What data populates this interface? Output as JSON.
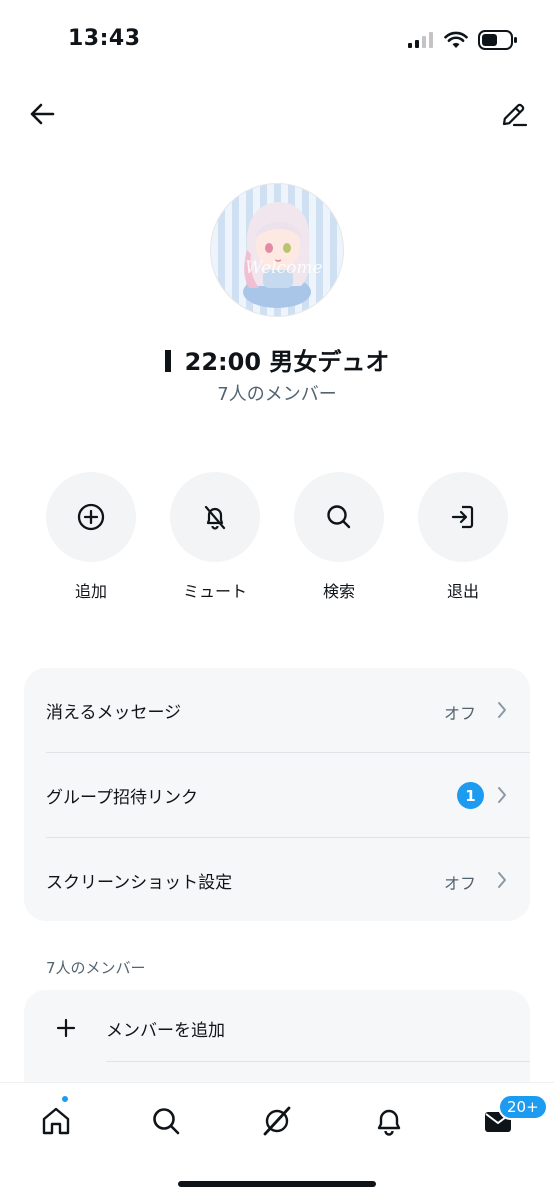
{
  "status": {
    "time": "13:43"
  },
  "group": {
    "title": "22:00 男女デュオ",
    "member_count": "7人のメンバー",
    "avatar_text": "Welcome"
  },
  "actions": [
    {
      "icon": "add-circle-icon",
      "label": "追加"
    },
    {
      "icon": "bell-off-icon",
      "label": "ミュート"
    },
    {
      "icon": "search-icon",
      "label": "検索"
    },
    {
      "icon": "leave-icon",
      "label": "退出"
    }
  ],
  "settings": [
    {
      "label": "消えるメッセージ",
      "value": "オフ"
    },
    {
      "label": "グループ招待リンク",
      "badge": "1"
    },
    {
      "label": "スクリーンショット設定",
      "value": "オフ"
    }
  ],
  "members_section": {
    "header": "7人のメンバー",
    "add_label": "メンバーを追加"
  },
  "tab_bar": {
    "messages_badge": "20+"
  },
  "colors": {
    "accent": "#1d9bf0",
    "text": "#0f1419",
    "secondary": "#536471",
    "card": "#f6f7f8"
  }
}
